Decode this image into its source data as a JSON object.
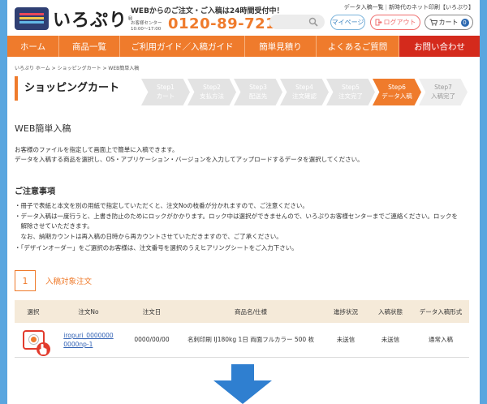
{
  "header": {
    "logo_text": "いろぷり",
    "order_headline": "WEBからのご注文・ご入稿は24時間受付中！",
    "center_label_1": "お客様センター",
    "center_label_2": "10:00〜17:00",
    "phone": "0120-89-7216",
    "top_link_1": "データ入稿一覧",
    "top_link_2": "新時代のネット印刷【いろぷり】",
    "mypage": "マイページ",
    "logout": "ログアウト",
    "cart": "カート",
    "cart_count": "0"
  },
  "nav": [
    "ホーム",
    "商品一覧",
    "ご利用ガイド／入稿ガイド",
    "簡単見積り",
    "よくあるご質問",
    "お問い合わせ"
  ],
  "breadcrumb": "いろぷり ホーム > ショッピングカート > WEB簡単入稿",
  "page_title": "ショッピングカート",
  "steps": [
    {
      "step": "Step1",
      "label": "カート"
    },
    {
      "step": "Step2",
      "label": "支払方法"
    },
    {
      "step": "Step3",
      "label": "配送先"
    },
    {
      "step": "Step4",
      "label": "注文確認"
    },
    {
      "step": "Step5",
      "label": "注文完了"
    },
    {
      "step": "Step6",
      "label": "データ入稿"
    },
    {
      "step": "Step7",
      "label": "入稿完了"
    }
  ],
  "main": {
    "heading": "WEB簡単入稿",
    "desc_1": "お客様のファイルを指定して画面上で簡単に入稿できます。",
    "desc_2": "データを入稿する商品を選択し、OS・アプリケーション・バージョンを入力してアップロードするデータを選択してください。",
    "notes_heading": "ご注意事項",
    "notes": [
      "・冊子で表紙と本文を別の用紙で指定していただくと、注文Noの枝番が分かれますので、ご注意ください。",
      "・データ入稿は一度行うと、上書き防止のためにロックがかかります。ロック中は選択ができませんので、いろぷりお客様センターまでご連絡ください。ロックを",
      "　解除させていただきます。",
      "　なお、納期カウントは再入稿の日時から再カウントさせていただきますので、ご了承ください。",
      "・「デザインオーダー」をご選択のお客様は、注文番号を選択のうえヒアリングシートをご入力下さい。"
    ],
    "section_num": "1",
    "section_title": "入稿対象注文"
  },
  "table": {
    "headers": [
      "選択",
      "注文No",
      "注文日",
      "商品名/仕様",
      "進捗状況",
      "入稿状態",
      "データ入稿形式"
    ],
    "row": {
      "order_no_1": "iropuri_0000000",
      "order_no_2": "0000np-1",
      "date": "0000/00/00",
      "product": "名刺印刷 IJ180kg 1日 両面フルカラー 500 枚",
      "progress": "未送信",
      "status": "未送信",
      "format": "通常入稿"
    }
  },
  "colors": {
    "accent": "#ef7b2c",
    "contact": "#d42a1c",
    "arrow": "#2f7fd0",
    "background": "#5aa6df"
  }
}
